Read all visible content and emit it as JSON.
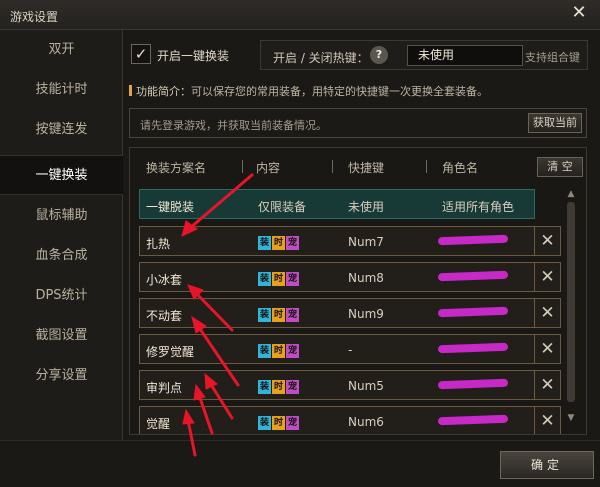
{
  "window": {
    "title": "游戏设置",
    "close_glyph": "✕"
  },
  "sidebar": {
    "items": [
      {
        "label": "双开"
      },
      {
        "label": "技能计时"
      },
      {
        "label": "按键连发"
      },
      {
        "label": "一键换装",
        "active": true
      },
      {
        "label": "鼠标辅助"
      },
      {
        "label": "血条合成"
      },
      {
        "label": "DPS统计"
      },
      {
        "label": "截图设置"
      },
      {
        "label": "分享设置"
      }
    ]
  },
  "main": {
    "enable_checkbox": {
      "checked": true,
      "label": "开启一键换装"
    },
    "hotkey": {
      "label": "开启 / 关闭热键：",
      "help_glyph": "?",
      "value": "未使用",
      "support_text": "支持组合键"
    },
    "intro": {
      "label": "功能简介：",
      "text": "可以保存您的常用装备，用特定的快捷键一次更换全套装备。"
    },
    "login": {
      "message": "请先登录游戏，并获取当前装备情况。",
      "fetch_button": "获取当前"
    },
    "table": {
      "headers": [
        "换装方案名",
        "内容",
        "快捷键",
        "角色名"
      ],
      "clear_button": "清 空",
      "tag_labels": [
        "装",
        "时",
        "宠"
      ],
      "rows": [
        {
          "name": "一键脱装",
          "content": "仅限装备",
          "hotkey": "未使用",
          "role": "适用所有角色"
        },
        {
          "name": "扎热",
          "hotkey": "Num7",
          "role_redacted": true
        },
        {
          "name": "小冰套",
          "hotkey": "Num8",
          "role_redacted": true
        },
        {
          "name": "不动套",
          "hotkey": "Num9",
          "role_redacted": true
        },
        {
          "name": "修罗觉醒",
          "hotkey": "-",
          "role_redacted": true
        },
        {
          "name": "审判点",
          "hotkey": "Num5",
          "role_redacted": true
        },
        {
          "name": "觉醒",
          "hotkey": "Num6",
          "role_redacted": true
        }
      ],
      "delete_glyph": "✕"
    }
  },
  "footer": {
    "ok_button": "确定"
  },
  "colors": {
    "accent_row": "#173a36",
    "annotation": "#e8142a",
    "redaction": "#d52ad5"
  }
}
